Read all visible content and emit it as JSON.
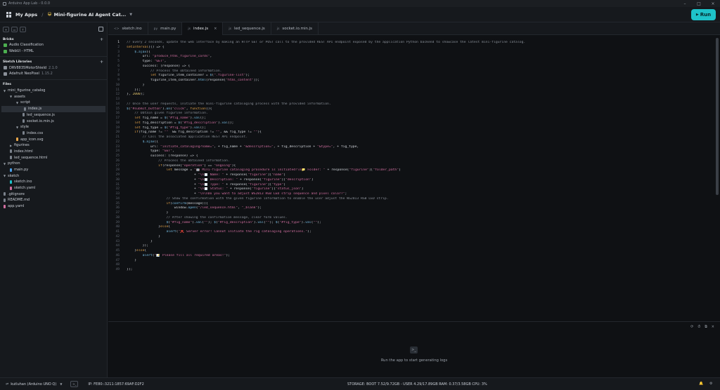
{
  "window": {
    "title": "Arduino App Lab - 0.0.0",
    "min_label": "–",
    "max_label": "□",
    "close_label": "×"
  },
  "appbar": {
    "my_apps": "My Apps",
    "separator": "/",
    "app_emoji": "😀",
    "app_name": "Mini-figurine AI Agent Cat...",
    "run_label": "Run"
  },
  "sidebar": {
    "bricks_title": "Bricks",
    "bricks": [
      {
        "label": "Audio Classification",
        "color": "#4caf50"
      },
      {
        "label": "WebUI - HTML",
        "color": "#4caf50"
      }
    ],
    "libraries_title": "Sketch Libraries",
    "libraries": [
      {
        "label": "DRV8835MotorShield",
        "version": "2.1.0"
      },
      {
        "label": "Adafruit NeoPixel",
        "version": "1.15.2"
      }
    ],
    "files_title": "Files",
    "files": [
      {
        "label": "mini_figurine_catalog",
        "depth": 0,
        "kind": "folder-open"
      },
      {
        "label": "assets",
        "depth": 1,
        "kind": "folder-open"
      },
      {
        "label": "script",
        "depth": 2,
        "kind": "folder-open"
      },
      {
        "label": "index.js",
        "depth": 3,
        "kind": "file",
        "selected": true
      },
      {
        "label": "led_sequence.js",
        "depth": 3,
        "kind": "file"
      },
      {
        "label": "socket.io.min.js",
        "depth": 3,
        "kind": "file"
      },
      {
        "label": "style",
        "depth": 2,
        "kind": "folder-open"
      },
      {
        "label": "index.css",
        "depth": 3,
        "kind": "file"
      },
      {
        "label": "app_icon.svg",
        "depth": 2,
        "kind": "svg"
      },
      {
        "label": "figurines",
        "depth": 1,
        "kind": "folder-closed"
      },
      {
        "label": "index.html",
        "depth": 1,
        "kind": "file"
      },
      {
        "label": "led_sequence.html",
        "depth": 1,
        "kind": "file"
      },
      {
        "label": "python",
        "depth": 0,
        "kind": "folder-open"
      },
      {
        "label": "main.py",
        "depth": 1,
        "kind": "py"
      },
      {
        "label": "sketch",
        "depth": 0,
        "kind": "folder-open"
      },
      {
        "label": "sketch.ino",
        "depth": 1,
        "kind": "ino"
      },
      {
        "label": "sketch.yaml",
        "depth": 1,
        "kind": "yaml"
      },
      {
        "label": ".gitignore",
        "depth": 0,
        "kind": "file"
      },
      {
        "label": "README.md",
        "depth": 0,
        "kind": "file"
      },
      {
        "label": "app.yaml",
        "depth": 0,
        "kind": "yaml"
      }
    ]
  },
  "tabs": [
    {
      "label": "sketch.ino",
      "icon": "<>"
    },
    {
      "label": "main.py",
      "icon": "py"
    },
    {
      "label": "index.js",
      "icon": "js",
      "active": true
    },
    {
      "label": "led_sequence.js",
      "icon": "js"
    },
    {
      "label": "socket.io.min.js",
      "icon": "js"
    }
  ],
  "editor": {
    "current_line": 1,
    "lines": [
      [
        [
          "cmt",
          "// Every 2 seconds, update the web interface by making an HTTP GET or POST call to the provided REST API endpoint exposed by the application Python backend to showcase the latest mini-figurine catalog."
        ]
      ],
      [
        [
          "kw",
          "setInterval"
        ],
        [
          "",
          "(() => {"
        ]
      ],
      [
        [
          "",
          "    "
        ],
        [
          "fn",
          "$.ajax"
        ],
        [
          "",
          "({"
        ]
      ],
      [
        [
          "",
          "        url: "
        ],
        [
          "str",
          "\"produce_html_figurine_cards\""
        ],
        [
          "",
          ","
        ]
      ],
      [
        [
          "",
          "        type: "
        ],
        [
          "str",
          "\"GET\""
        ],
        [
          "",
          ","
        ]
      ],
      [
        [
          "",
          "        success: (response) => {"
        ]
      ],
      [
        [
          "",
          "            "
        ],
        [
          "cmt",
          "// Process the obtained information."
        ]
      ],
      [
        [
          "",
          "            "
        ],
        [
          "kw",
          "let"
        ],
        [
          "",
          " figurine_item_container = "
        ],
        [
          "fn",
          "$"
        ],
        [
          "",
          "("
        ],
        [
          "str",
          "\".figurine-list\""
        ],
        [
          "",
          ");"
        ]
      ],
      [
        [
          "",
          "            figurine_item_container."
        ],
        [
          "fn",
          "html"
        ],
        [
          "",
          "(response["
        ],
        [
          "str",
          "\"html_content\""
        ],
        [
          "",
          "]);"
        ]
      ],
      [
        [
          "",
          "        }"
        ]
      ],
      [
        [
          "",
          "    });"
        ]
      ],
      [
        [
          "",
          "}, "
        ],
        [
          "num",
          "2000"
        ],
        [
          "",
          ");"
        ]
      ],
      [
        [
          "",
          ""
        ]
      ],
      [
        [
          "cmt",
          "// Once the user requests, initiate the mini-figurine cataloging process with the provided information."
        ]
      ],
      [
        [
          "fn",
          "$"
        ],
        [
          "",
          "("
        ],
        [
          "str",
          "\"#submit_button\""
        ],
        [
          "",
          ")."
        ],
        [
          "fn",
          "on"
        ],
        [
          "",
          "("
        ],
        [
          "str",
          "\"click\""
        ],
        [
          "",
          ", "
        ],
        [
          "kw",
          "function"
        ],
        [
          "",
          "(){"
        ]
      ],
      [
        [
          "",
          "    "
        ],
        [
          "cmt",
          "// Obtain given figurine information."
        ]
      ],
      [
        [
          "",
          "    "
        ],
        [
          "kw",
          "let"
        ],
        [
          "",
          " fig_name = "
        ],
        [
          "fn",
          "$"
        ],
        [
          "",
          "("
        ],
        [
          "str",
          "\"#fig_name\""
        ],
        [
          "",
          ")."
        ],
        [
          "fn",
          "val"
        ],
        [
          "",
          "();"
        ]
      ],
      [
        [
          "",
          "    "
        ],
        [
          "kw",
          "let"
        ],
        [
          "",
          " fig_description = "
        ],
        [
          "fn",
          "$"
        ],
        [
          "",
          "("
        ],
        [
          "str",
          "\"#fig_description\""
        ],
        [
          "",
          ")."
        ],
        [
          "fn",
          "val"
        ],
        [
          "",
          "();"
        ]
      ],
      [
        [
          "",
          "    "
        ],
        [
          "kw",
          "let"
        ],
        [
          "",
          " fig_type = "
        ],
        [
          "fn",
          "$"
        ],
        [
          "",
          "("
        ],
        [
          "str",
          "\"#fig_type\""
        ],
        [
          "",
          ")."
        ],
        [
          "fn",
          "val"
        ],
        [
          "",
          "();"
        ]
      ],
      [
        [
          "",
          "    "
        ],
        [
          "kw",
          "if"
        ],
        [
          "",
          "(fig_name != "
        ],
        [
          "str",
          "\"\""
        ],
        [
          "",
          "  && fig_description != "
        ],
        [
          "str",
          "\"\""
        ],
        [
          "",
          ", && fig_type != "
        ],
        [
          "str",
          "\"\""
        ],
        [
          "",
          "){"
        ]
      ],
      [
        [
          "",
          "        "
        ],
        [
          "cmt",
          "// Call the associated application REST API endpoint."
        ]
      ],
      [
        [
          "",
          "        "
        ],
        [
          "fn",
          "$.ajax"
        ],
        [
          "",
          "({"
        ]
      ],
      [
        [
          "",
          "            url: "
        ],
        [
          "str",
          "\"initiate_cataloging?name=\""
        ],
        [
          "",
          ", + fig_name + "
        ],
        [
          "str",
          "\"&description=\""
        ],
        [
          "",
          ", + fig_description + "
        ],
        [
          "str",
          "\"&type=\""
        ],
        [
          "",
          ", + fig_type,"
        ]
      ],
      [
        [
          "",
          "            type: "
        ],
        [
          "str",
          "\"GET\""
        ],
        [
          "",
          ","
        ]
      ],
      [
        [
          "",
          "            success: (response) => {"
        ]
      ],
      [
        [
          "",
          "                "
        ],
        [
          "cmt",
          "// Process the obtained information."
        ]
      ],
      [
        [
          "",
          "                "
        ],
        [
          "kw",
          "if"
        ],
        [
          "",
          "(response["
        ],
        [
          "str",
          "\"operation\""
        ],
        [
          "",
          "] == "
        ],
        [
          "str",
          "\"ongoing\""
        ],
        [
          "",
          "){"
        ]
      ],
      [
        [
          "",
          "                    "
        ],
        [
          "kw",
          "let"
        ],
        [
          "",
          " message = "
        ],
        [
          "str",
          "\"🤖 Mini-figurine cataloging procedure is initiated!\\n📁 Folder: \""
        ],
        [
          "",
          " + response["
        ],
        [
          "str",
          "\"figurine\""
        ],
        [
          "",
          "]["
        ],
        [
          "str",
          "\"folder_path\""
        ],
        [
          "",
          "]"
        ]
      ],
      [
        [
          "",
          "                                  + "
        ],
        [
          "str",
          "\"\\n📄 Name: \""
        ],
        [
          "",
          " + response["
        ],
        [
          "str",
          "\"figurine\""
        ],
        [
          "",
          "]["
        ],
        [
          "str",
          "\"name\""
        ],
        [
          "",
          "]"
        ]
      ],
      [
        [
          "",
          "                                  + "
        ],
        [
          "str",
          "\"\\n📄 Description: \""
        ],
        [
          "",
          " + response["
        ],
        [
          "str",
          "\"figurine\""
        ],
        [
          "",
          "]["
        ],
        [
          "str",
          "\"description\""
        ],
        [
          "",
          "]"
        ]
      ],
      [
        [
          "",
          "                                  + "
        ],
        [
          "str",
          "\"\\n📄 Type: \""
        ],
        [
          "",
          " + response["
        ],
        [
          "str",
          "\"figurine\""
        ],
        [
          "",
          "]["
        ],
        [
          "str",
          "\"type\""
        ],
        [
          "",
          "]"
        ]
      ],
      [
        [
          "",
          "                                  + "
        ],
        [
          "str",
          "\"\\n📄 Status: \""
        ],
        [
          "",
          " + response["
        ],
        [
          "str",
          "\"figurine\""
        ],
        [
          "",
          "]["
        ],
        [
          "str",
          "\"status_json\""
        ],
        [
          "",
          "]"
        ]
      ],
      [
        [
          "",
          "                                  + "
        ],
        [
          "str",
          "\"\\n\\nDo you want to adjust WS2813 RGB LED strip sequence and pixel color?\""
        ],
        [
          "",
          ";"
        ]
      ],
      [
        [
          "",
          "                    "
        ],
        [
          "cmt",
          "// Show the confirmation with the given figurine information to enable the user adjust the WS2813 RGB LED strip."
        ]
      ],
      [
        [
          "",
          "                    "
        ],
        [
          "kw",
          "if"
        ],
        [
          "",
          "("
        ],
        [
          "fn",
          "confirm"
        ],
        [
          "",
          "(message)){"
        ]
      ],
      [
        [
          "",
          "                        window."
        ],
        [
          "fn",
          "open"
        ],
        [
          "",
          "("
        ],
        [
          "str",
          "\"/led_sequence.html\""
        ],
        [
          "",
          ", "
        ],
        [
          "str",
          "\"_blank\""
        ],
        [
          "",
          ");"
        ]
      ],
      [
        [
          "",
          "                    }"
        ]
      ],
      [
        [
          "",
          "                    "
        ],
        [
          "cmt",
          "// After showing the confirmation message, clear form values."
        ]
      ],
      [
        [
          "",
          "                    "
        ],
        [
          "fn",
          "$"
        ],
        [
          "",
          "("
        ],
        [
          "str",
          "\"#fig_name\""
        ],
        [
          "",
          ")."
        ],
        [
          "fn",
          "val"
        ],
        [
          "",
          "("
        ],
        [
          "str",
          "\"\""
        ],
        [
          "",
          "); "
        ],
        [
          "fn",
          "$"
        ],
        [
          "",
          "("
        ],
        [
          "str",
          "\"#fig_description\""
        ],
        [
          "",
          ")."
        ],
        [
          "fn",
          "val"
        ],
        [
          "",
          "("
        ],
        [
          "str",
          "\"\""
        ],
        [
          "",
          "); "
        ],
        [
          "fn",
          "$"
        ],
        [
          "",
          "("
        ],
        [
          "str",
          "\"#fig_type\""
        ],
        [
          "",
          ")."
        ],
        [
          "fn",
          "val"
        ],
        [
          "",
          "("
        ],
        [
          "str",
          "\"\""
        ],
        [
          "",
          ");"
        ]
      ],
      [
        [
          "",
          "                }"
        ],
        [
          "kw",
          "else"
        ],
        [
          "",
          "{"
        ]
      ],
      [
        [
          "",
          "                    "
        ],
        [
          "fn",
          "alert"
        ],
        [
          "",
          "("
        ],
        [
          "str",
          "\"❌ Server error! Cannot initiate the rig cataloging operations.\""
        ],
        [
          "",
          ");"
        ]
      ],
      [
        [
          "",
          "                }"
        ]
      ],
      [
        [
          "",
          "            }"
        ]
      ],
      [
        [
          "",
          "        });"
        ]
      ],
      [
        [
          "",
          "    }"
        ],
        [
          "kw",
          "else"
        ],
        [
          "",
          "{"
        ]
      ],
      [
        [
          "",
          "        "
        ],
        [
          "fn",
          "alert"
        ],
        [
          "",
          "("
        ],
        [
          "str",
          "\"📝 Please fill all required areas!\""
        ],
        [
          "",
          ");"
        ]
      ],
      [
        [
          "",
          "    }"
        ]
      ],
      [
        [
          "",
          ""
        ]
      ],
      [
        [
          "",
          "});"
        ]
      ]
    ]
  },
  "panel": {
    "empty_text": "Run the app to start generating logs",
    "tools": [
      "⟳",
      "⏱",
      "⧉",
      "×"
    ]
  },
  "statusbar": {
    "board": "kutluhan (Arduino UNO Q)",
    "ip": "IP: FE80::3211:1857:69AF:D2F2",
    "stats": "STORAGE: BOOT 7.52/9.72GB - USER 4.29/17.89GB   RAM: 0.37/3.58GB   CPU: 3%"
  }
}
